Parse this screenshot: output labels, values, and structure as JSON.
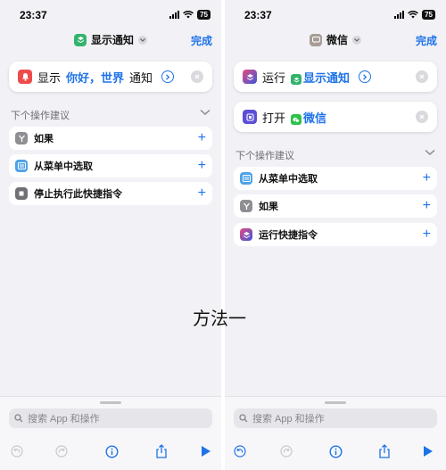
{
  "accent_color": "#1f73e8",
  "left": {
    "status": {
      "time": "23:37",
      "battery": "75"
    },
    "nav": {
      "title": "显示通知",
      "done": "完成",
      "icon": "notification-app-icon"
    },
    "action": {
      "verb": "显示",
      "param": "你好，世界",
      "noun": "通知"
    },
    "suggest_header": "下个操作建议",
    "suggestions": [
      {
        "label": "如果",
        "icon": "if-icon"
      },
      {
        "label": "从菜单中选取",
        "icon": "menu-icon"
      },
      {
        "label": "停止执行此快捷指令",
        "icon": "stop-icon"
      }
    ],
    "search_placeholder": "搜索 App 和操作"
  },
  "right": {
    "status": {
      "time": "23:37",
      "battery": "75"
    },
    "nav": {
      "title": "微信",
      "done": "完成",
      "icon": "wechat-app-icon"
    },
    "action1": {
      "verb": "运行",
      "param": "显示通知"
    },
    "action2": {
      "verb": "打开",
      "param": "微信"
    },
    "suggest_header": "下个操作建议",
    "suggestions": [
      {
        "label": "从菜单中选取",
        "icon": "menu-icon"
      },
      {
        "label": "如果",
        "icon": "if-icon"
      },
      {
        "label": "运行快捷指令",
        "icon": "shortcuts-icon"
      }
    ],
    "search_placeholder": "搜索 App 和操作"
  },
  "caption": "方法一"
}
